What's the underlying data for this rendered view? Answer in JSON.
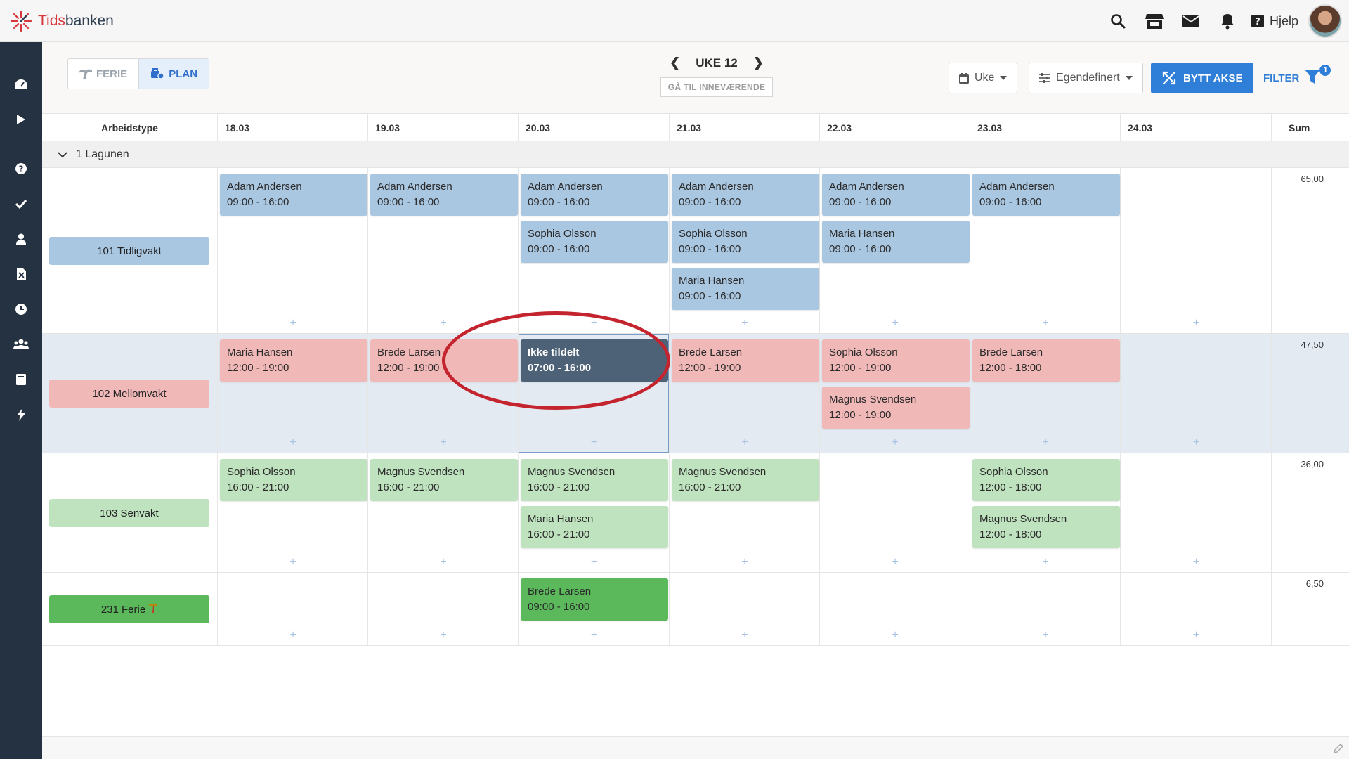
{
  "app": {
    "name_part1": "Tids",
    "name_part2": "banken",
    "help_label": "Hjelp"
  },
  "toolbar": {
    "ferie_label": "FERIE",
    "plan_label": "PLAN",
    "week_label": "UKE 12",
    "goto_current_label": "GÅ TIL INNEVÆRENDE",
    "view_select": "Uke",
    "custom_select": "Egendefinert",
    "swap_axis_label": "BYTT AKSE",
    "filter_label": "FILTER",
    "filter_count": "1"
  },
  "columns": {
    "type_header": "Arbeidstype",
    "dates": [
      "18.03",
      "19.03",
      "20.03",
      "21.03",
      "22.03",
      "23.03",
      "24.03"
    ],
    "sum_header": "Sum"
  },
  "group": {
    "label": "1 Lagunen"
  },
  "rows": [
    {
      "worktype": "101 Tidligvakt",
      "sum": "65,00",
      "days": [
        [
          {
            "name": "Adam Andersen",
            "time": "09:00 - 16:00"
          }
        ],
        [
          {
            "name": "Adam Andersen",
            "time": "09:00 - 16:00"
          }
        ],
        [
          {
            "name": "Adam Andersen",
            "time": "09:00 - 16:00"
          },
          {
            "name": "Sophia Olsson",
            "time": "09:00 - 16:00"
          }
        ],
        [
          {
            "name": "Adam Andersen",
            "time": "09:00 - 16:00"
          },
          {
            "name": "Sophia Olsson",
            "time": "09:00 - 16:00"
          },
          {
            "name": "Maria Hansen",
            "time": "09:00 - 16:00"
          }
        ],
        [
          {
            "name": "Adam Andersen",
            "time": "09:00 - 16:00"
          },
          {
            "name": "Maria Hansen",
            "time": "09:00 - 16:00"
          }
        ],
        [
          {
            "name": "Adam Andersen",
            "time": "09:00 - 16:00"
          }
        ],
        []
      ]
    },
    {
      "worktype": "102 Mellomvakt",
      "sum": "47,50",
      "days": [
        [
          {
            "name": "Maria Hansen",
            "time": "12:00 - 19:00"
          }
        ],
        [
          {
            "name": "Brede Larsen",
            "time": "12:00 - 19:00"
          }
        ],
        [
          {
            "name": "Ikke tildelt",
            "time": "07:00 - 16:00"
          }
        ],
        [
          {
            "name": "Brede Larsen",
            "time": "12:00 - 19:00"
          }
        ],
        [
          {
            "name": "Sophia Olsson",
            "time": "12:00 - 19:00"
          },
          {
            "name": "Magnus Svendsen",
            "time": "12:00 - 19:00"
          }
        ],
        [
          {
            "name": "Brede Larsen",
            "time": "12:00 - 18:00"
          }
        ],
        []
      ]
    },
    {
      "worktype": "103 Senvakt",
      "sum": "36,00",
      "days": [
        [
          {
            "name": "Sophia Olsson",
            "time": "16:00 - 21:00"
          }
        ],
        [
          {
            "name": "Magnus Svendsen",
            "time": "16:00 - 21:00"
          }
        ],
        [
          {
            "name": "Magnus Svendsen",
            "time": "16:00 - 21:00"
          },
          {
            "name": "Maria Hansen",
            "time": "16:00 - 21:00"
          }
        ],
        [
          {
            "name": "Magnus Svendsen",
            "time": "16:00 - 21:00"
          }
        ],
        [],
        [
          {
            "name": "Sophia Olsson",
            "time": "12:00 - 18:00"
          },
          {
            "name": "Magnus Svendsen",
            "time": "12:00 - 18:00"
          }
        ],
        []
      ]
    },
    {
      "worktype": "231 Ferie",
      "sum": "6,50",
      "days": [
        [],
        [],
        [
          {
            "name": "Brede Larsen",
            "time": "09:00 - 16:00"
          }
        ],
        [],
        [],
        [],
        []
      ]
    }
  ],
  "colors": {
    "sidebar": "#243241",
    "accent": "#2f7fd8",
    "tidligvakt": "#aac7e2",
    "mellomvakt": "#f1b8b8",
    "senvakt": "#bfe2bf",
    "ferie": "#5bb85b",
    "unassigned": "#4e6277",
    "annotation": "#c4242e"
  }
}
